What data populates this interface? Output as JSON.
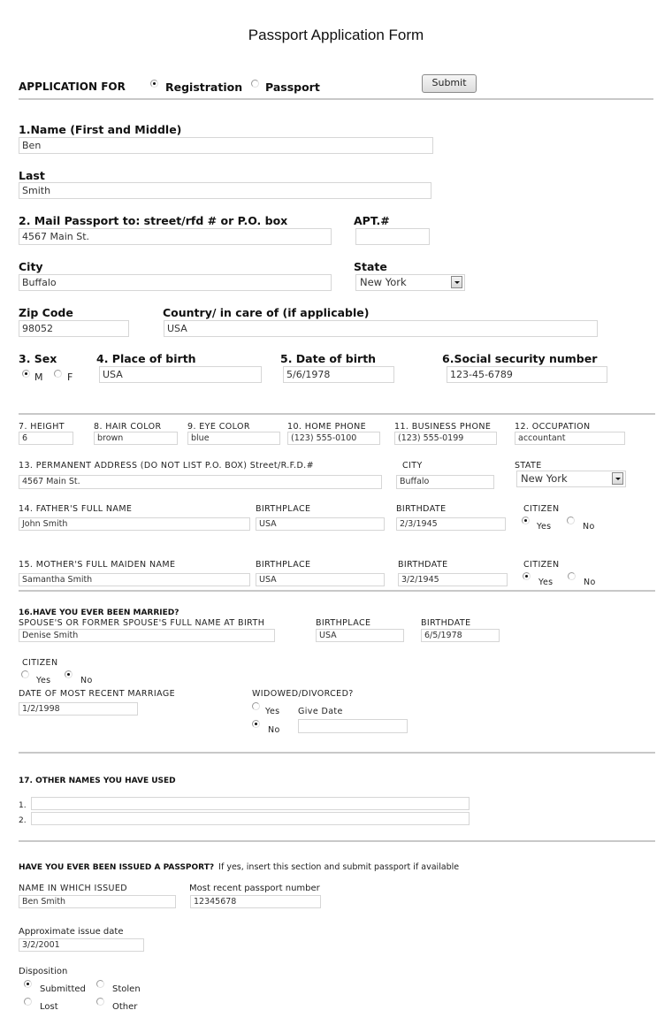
{
  "title": "Passport Application Form",
  "application_for": {
    "label": "APPLICATION FOR",
    "options": [
      {
        "label": "Registration",
        "selected": true
      },
      {
        "label": "Passport",
        "selected": false
      }
    ],
    "submit_label": "Submit"
  },
  "section1": {
    "first_middle_label": "1.Name (First and Middle)",
    "first_middle_value": "Ben",
    "last_label": "Last",
    "last_value": "Smith",
    "mail_label": "2. Mail Passport to: street/rfd # or P.O. box",
    "mail_value": "4567 Main St.",
    "apt_label": "APT.#",
    "apt_value": "",
    "city_label": "City",
    "city_value": "Buffalo",
    "state_label": "State",
    "state_value": "New York",
    "zip_label": "Zip Code",
    "zip_value": "98052",
    "country_label": "Country/ in care of (if applicable)",
    "country_value": "USA",
    "sex_label": "3. Sex",
    "sex_options": [
      {
        "label": "M",
        "selected": true
      },
      {
        "label": "F",
        "selected": false
      }
    ],
    "pob_label": "4. Place of birth",
    "pob_value": "USA",
    "dob_label": "5. Date of birth",
    "dob_value": "5/6/1978",
    "ssn_label": "6.Social security number",
    "ssn_value": "123-45-6789"
  },
  "section2": {
    "height_label": "7. HEIGHT",
    "height_value": "6",
    "hair_label": "8. HAIR COLOR",
    "hair_value": "brown",
    "eye_label": "9. EYE COLOR",
    "eye_value": "blue",
    "home_phone_label": "10. HOME PHONE",
    "home_phone_value": "(123) 555-0100",
    "business_phone_label": "11. BUSINESS PHONE",
    "business_phone_value": "(123) 555-0199",
    "occupation_label": "12. OCCUPATION",
    "occupation_value": "accountant",
    "perm_address_label": "13. PERMANENT ADDRESS (DO NOT LIST P.O. BOX) Street/R.F.D.#",
    "perm_address_value": "4567 Main St.",
    "perm_city_label": "CITY",
    "perm_city_value": "Buffalo",
    "perm_state_label": "STATE",
    "perm_state_value": "New York",
    "father_label": "14. FATHER'S FULL NAME",
    "father_value": "John Smith",
    "father_birthplace_label": "BIRTHPLACE",
    "father_birthplace_value": "USA",
    "father_birthdate_label": "BIRTHDATE",
    "father_birthdate_value": "2/3/1945",
    "father_citizen_label": "CITIZEN",
    "father_citizen_options": [
      {
        "label": "Yes",
        "selected": true
      },
      {
        "label": "No",
        "selected": false
      }
    ],
    "mother_label": "15. MOTHER'S FULL MAIDEN NAME",
    "mother_value": "Samantha Smith",
    "mother_birthplace_label": "BIRTHPLACE",
    "mother_birthplace_value": "USA",
    "mother_birthdate_label": "BIRTHDATE",
    "mother_birthdate_value": "3/2/1945",
    "mother_citizen_label": "CITIZEN",
    "mother_citizen_options": [
      {
        "label": "Yes",
        "selected": true
      },
      {
        "label": "No",
        "selected": false
      }
    ]
  },
  "section3": {
    "married_heading": "16.HAVE YOU EVER BEEN MARRIED?",
    "spouse_label": "SPOUSE'S OR FORMER SPOUSE'S FULL NAME AT BIRTH",
    "spouse_value": "Denise Smith",
    "spouse_birthplace_label": "BIRTHPLACE",
    "spouse_birthplace_value": "USA",
    "spouse_birthdate_label": "BIRTHDATE",
    "spouse_birthdate_value": "6/5/1978",
    "spouse_citizen_label": "CITIZEN",
    "spouse_citizen_options": [
      {
        "label": "Yes",
        "selected": false
      },
      {
        "label": "No",
        "selected": true
      }
    ],
    "marriage_date_label": "DATE OF MOST RECENT MARRIAGE",
    "marriage_date_value": "1/2/1998",
    "widowed_label": "WIDOWED/DIVORCED?",
    "widowed_options": [
      {
        "label": "Yes",
        "selected": false
      },
      {
        "label": "No",
        "selected": true
      }
    ],
    "give_date_label": "Give Date",
    "give_date_value": ""
  },
  "section4": {
    "other_names_heading": "17. OTHER NAMES YOU HAVE USED",
    "other_names": [
      {
        "num": "1.",
        "value": ""
      },
      {
        "num": "2.",
        "value": ""
      }
    ]
  },
  "section5": {
    "issued_heading": "HAVE YOU EVER BEEN ISSUED A PASSPORT?",
    "issued_note": "If yes, insert this section and submit passport if available",
    "name_issued_label": "NAME IN WHICH ISSUED",
    "name_issued_value": "Ben Smith",
    "passport_number_label": "Most recent passport number",
    "passport_number_value": "12345678",
    "issue_date_label": "Approximate issue date",
    "issue_date_value": "3/2/2001",
    "disposition_label": "Disposition",
    "disposition_options": [
      {
        "label": "Submitted",
        "selected": true
      },
      {
        "label": "Stolen",
        "selected": false
      },
      {
        "label": "Lost",
        "selected": false
      },
      {
        "label": "Other",
        "selected": false
      }
    ]
  }
}
